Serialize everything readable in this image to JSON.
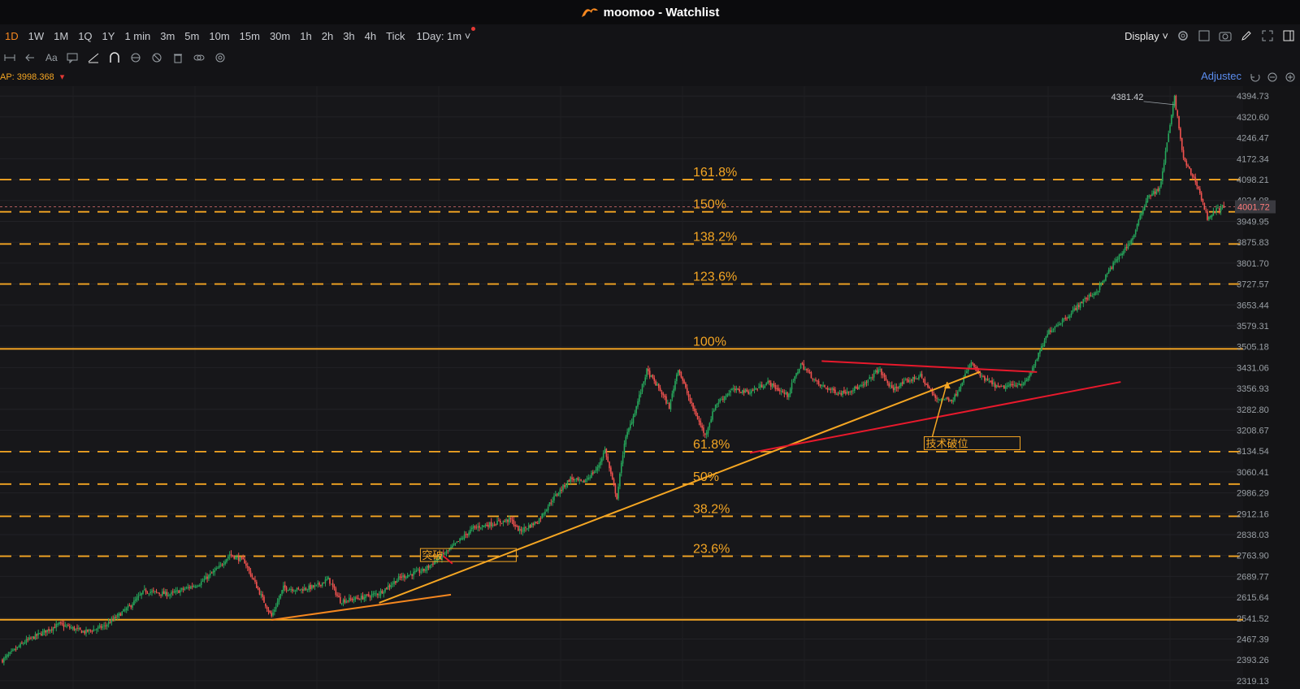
{
  "app": {
    "title": "moomoo - Watchlist"
  },
  "toolbar": {
    "timeframes": [
      "1D",
      "1W",
      "1M",
      "1Q",
      "1Y",
      "1 min",
      "3m",
      "5m",
      "10m",
      "15m",
      "30m",
      "1h",
      "2h",
      "3h",
      "4h",
      "Tick"
    ],
    "active_timeframe": "1D",
    "interval_select": "1Day: 1m",
    "display_label": "Display"
  },
  "indicator": {
    "vwap_label": "AP:",
    "vwap_value": "3998.368",
    "adjusted_label": "Adjustec"
  },
  "colors": {
    "up": "#26a65b",
    "down": "#f0524f",
    "accent": "#f5871f",
    "fib": "#f5a623",
    "trend_red": "#e8192c"
  },
  "chart_data": {
    "type": "candlestick",
    "ylim": [
      2290,
      4430
    ],
    "y_ticks": [
      4394.73,
      4320.6,
      4246.47,
      4172.34,
      4098.21,
      4024.08,
      3949.95,
      3875.83,
      3801.7,
      3727.57,
      3653.44,
      3579.31,
      3505.18,
      3431.06,
      3356.93,
      3282.8,
      3208.67,
      3134.54,
      3060.41,
      2986.29,
      2912.16,
      2838.03,
      2763.9,
      2689.77,
      2615.64,
      2541.52,
      2467.39,
      2393.26,
      2319.13
    ],
    "last_price": "4001.72",
    "last_price_value": 4001.72,
    "high_label": "4381.42",
    "high_value": 4381.42,
    "fib_levels": [
      {
        "label": "161.8%",
        "value": 4098.2,
        "style": "dashed"
      },
      {
        "label": "150%",
        "value": 3983.9,
        "style": "dashed"
      },
      {
        "label": "138.2%",
        "value": 3869.6,
        "style": "dashed"
      },
      {
        "label": "123.6%",
        "value": 3727.6,
        "style": "dashed"
      },
      {
        "label": "100%",
        "value": 3497.4,
        "style": "solid"
      },
      {
        "label": "61.8%",
        "value": 3132.6,
        "style": "dashed"
      },
      {
        "label": "50%",
        "value": 3017.3,
        "style": "dashed"
      },
      {
        "label": "38.2%",
        "value": 2903.1,
        "style": "dashed"
      },
      {
        "label": "23.6%",
        "value": 2761.3,
        "style": "dashed"
      },
      {
        "label": "",
        "value": 2535.7,
        "style": "solid"
      }
    ],
    "waypoints": [
      [
        0,
        2392
      ],
      [
        15,
        2458
      ],
      [
        38,
        2520
      ],
      [
        55,
        2492
      ],
      [
        68,
        2512
      ],
      [
        85,
        2582
      ],
      [
        95,
        2638
      ],
      [
        112,
        2626
      ],
      [
        132,
        2665
      ],
      [
        145,
        2722
      ],
      [
        152,
        2768
      ],
      [
        162,
        2742
      ],
      [
        174,
        2610
      ],
      [
        180,
        2548
      ],
      [
        188,
        2650
      ],
      [
        198,
        2642
      ],
      [
        210,
        2655
      ],
      [
        218,
        2680
      ],
      [
        226,
        2602
      ],
      [
        240,
        2614
      ],
      [
        252,
        2630
      ],
      [
        266,
        2686
      ],
      [
        282,
        2712
      ],
      [
        298,
        2780
      ],
      [
        315,
        2862
      ],
      [
        340,
        2891
      ],
      [
        346,
        2850
      ],
      [
        358,
        2885
      ],
      [
        368,
        2964
      ],
      [
        380,
        3038
      ],
      [
        388,
        3022
      ],
      [
        398,
        3073
      ],
      [
        403,
        3140
      ],
      [
        408,
        3028
      ],
      [
        411,
        2970
      ],
      [
        416,
        3165
      ],
      [
        423,
        3275
      ],
      [
        431,
        3420
      ],
      [
        440,
        3350
      ],
      [
        446,
        3290
      ],
      [
        452,
        3430
      ],
      [
        460,
        3310
      ],
      [
        470,
        3190
      ],
      [
        477,
        3300
      ],
      [
        488,
        3352
      ],
      [
        500,
        3345
      ],
      [
        512,
        3378
      ],
      [
        525,
        3332
      ],
      [
        534,
        3444
      ],
      [
        546,
        3370
      ],
      [
        560,
        3340
      ],
      [
        576,
        3366
      ],
      [
        586,
        3426
      ],
      [
        595,
        3353
      ],
      [
        604,
        3380
      ],
      [
        614,
        3402
      ],
      [
        624,
        3322
      ],
      [
        636,
        3318
      ],
      [
        648,
        3448
      ],
      [
        655,
        3395
      ],
      [
        667,
        3358
      ],
      [
        685,
        3380
      ],
      [
        700,
        3560
      ],
      [
        715,
        3625
      ],
      [
        722,
        3665
      ],
      [
        732,
        3702
      ],
      [
        742,
        3790
      ],
      [
        756,
        3890
      ],
      [
        766,
        4040
      ],
      [
        774,
        4064
      ],
      [
        784,
        4390
      ],
      [
        790,
        4170
      ],
      [
        799,
        4082
      ],
      [
        806,
        3962
      ],
      [
        812,
        3990
      ],
      [
        817,
        4001.72
      ]
    ],
    "labels": [
      {
        "text": "突破",
        "x": 285,
        "y": 2754
      },
      {
        "text": "技术破位",
        "x": 622,
        "y": 3151
      }
    ]
  }
}
